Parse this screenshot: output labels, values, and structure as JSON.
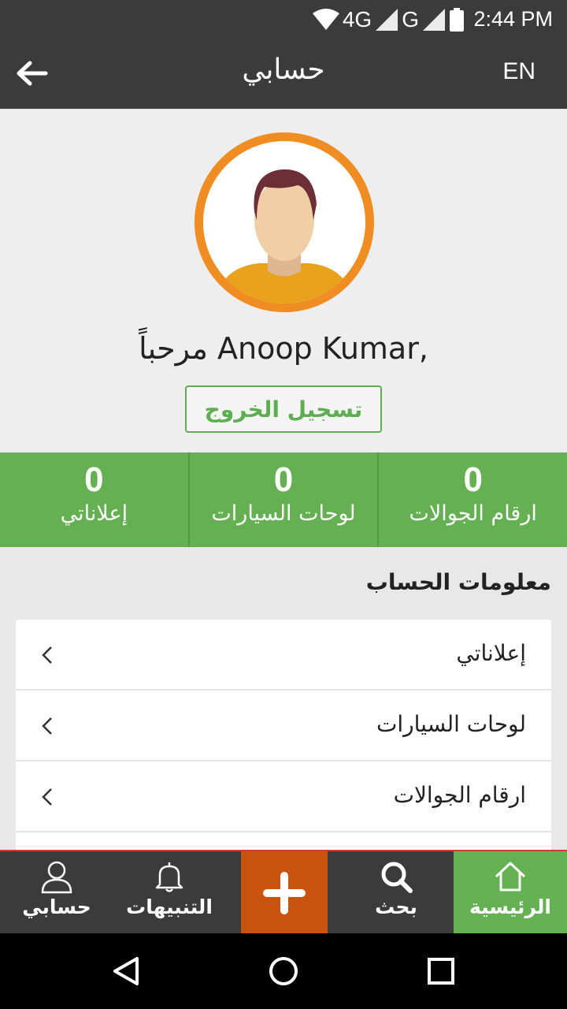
{
  "status_bar": {
    "network": "4G",
    "network2": "G",
    "time": "2:44 PM"
  },
  "app_bar": {
    "title": "حسابي",
    "lang": "EN"
  },
  "profile": {
    "welcome": "مرحباً Anoop Kumar,",
    "logout_label": "تسجيل الخروج"
  },
  "stats": [
    {
      "value": "0",
      "label": "إعلاناتي"
    },
    {
      "value": "0",
      "label": "لوحات السيارات"
    },
    {
      "value": "0",
      "label": "ارقام الجوالات"
    }
  ],
  "account_section": {
    "title": "معلومات الحساب"
  },
  "menu": [
    {
      "label": "إعلاناتي"
    },
    {
      "label": "لوحات السيارات"
    },
    {
      "label": "ارقام الجوالات"
    }
  ],
  "bottom_nav": {
    "home": "الرئيسية",
    "search": "بحث",
    "alerts": "التنبيهات",
    "account": "حسابي"
  },
  "colors": {
    "accent_green": "#65b052",
    "accent_orange": "#ef8c22",
    "add_button": "#c8530e",
    "bar": "#3b3b3b"
  }
}
